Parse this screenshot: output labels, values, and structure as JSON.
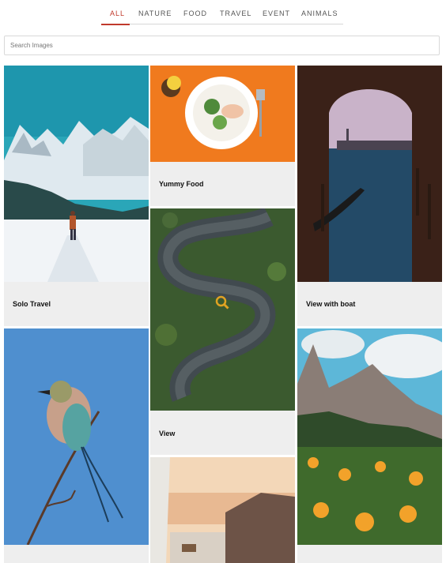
{
  "filter_tabs": [
    {
      "label": "ALL",
      "active": true
    },
    {
      "label": "NATURE",
      "active": false
    },
    {
      "label": "FOOD",
      "active": false
    },
    {
      "label": "TRAVEL",
      "active": false
    },
    {
      "label": "EVENT",
      "active": false
    },
    {
      "label": "ANIMALS",
      "active": false
    }
  ],
  "search": {
    "placeholder": "Search Images",
    "value": ""
  },
  "gallery": {
    "items": [
      {
        "caption": "Solo Travel"
      },
      {
        "caption": "Yummy Food"
      },
      {
        "caption": "View with boat"
      },
      {
        "caption": "View"
      }
    ]
  },
  "colors": {
    "accent": "#c0392b",
    "card_bg": "#eeeeee",
    "search_icon": "#e0a322"
  }
}
